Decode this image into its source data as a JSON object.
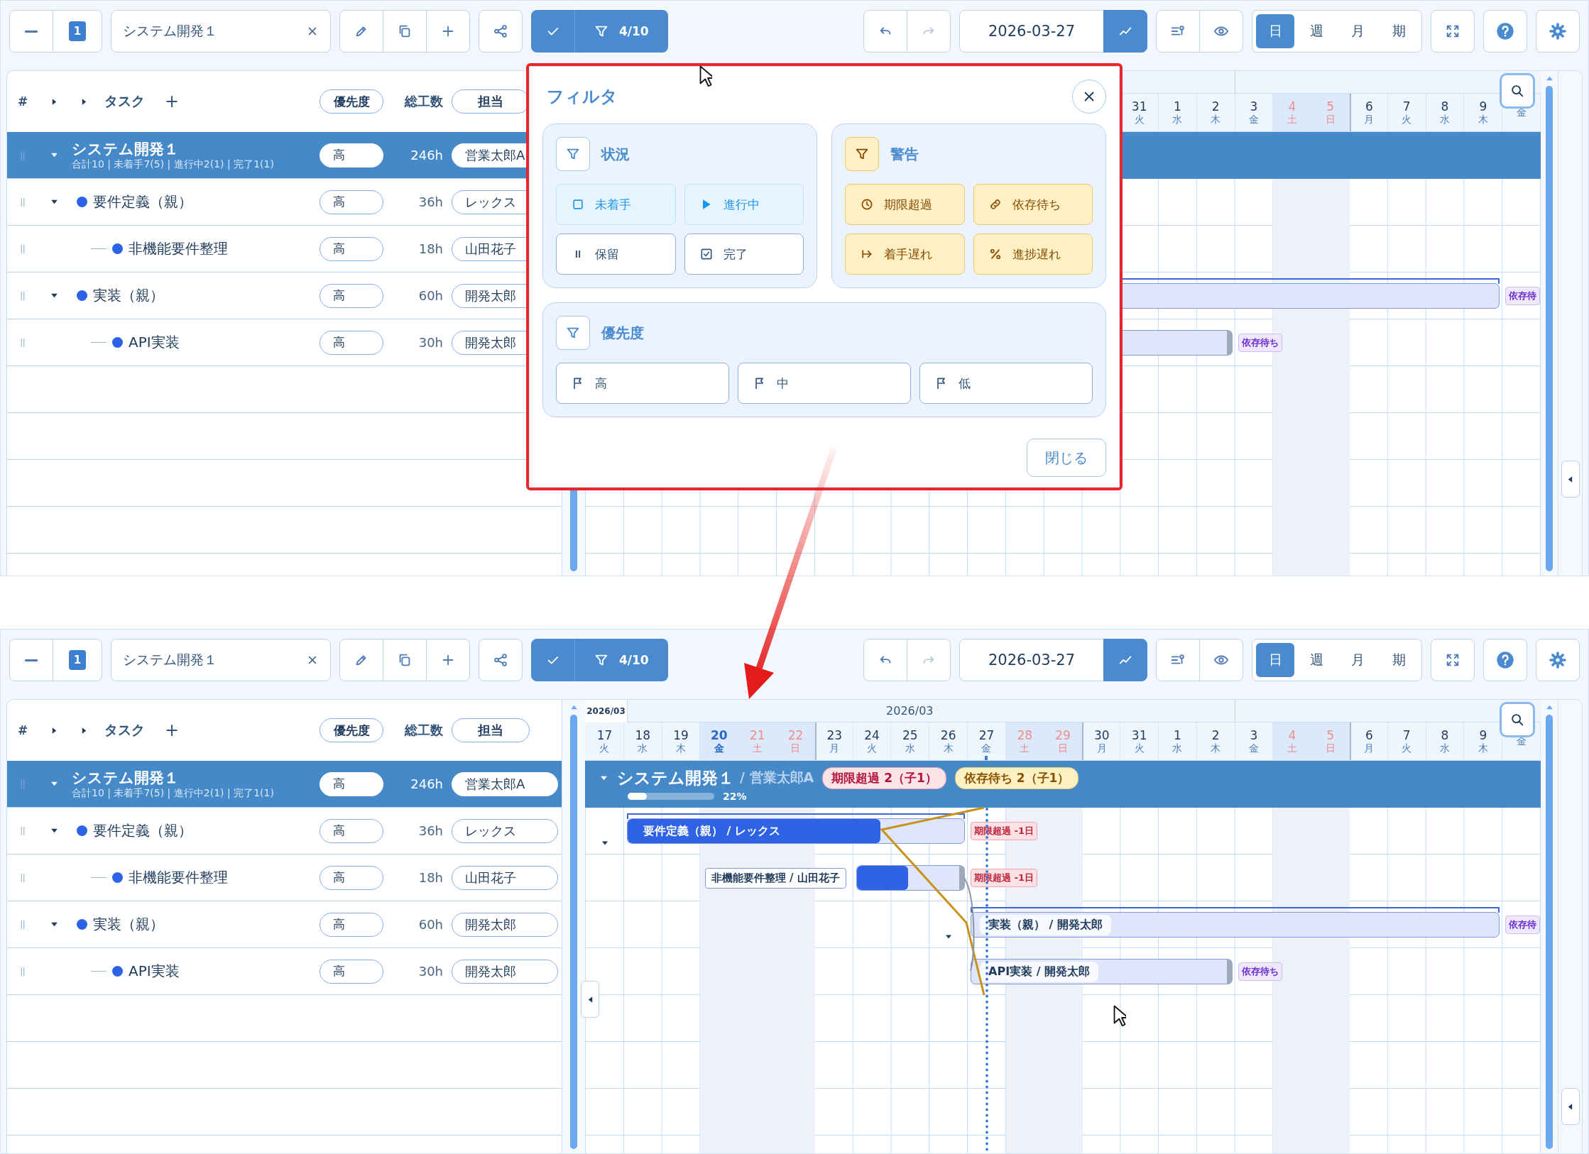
{
  "screens": [
    {
      "toolbar": {
        "level_badge": "1",
        "project": "システム開発１",
        "filter_active": true,
        "filter_count": "4/10",
        "undo_disabled": false,
        "redo_disabled": true,
        "date": "2026-03-27",
        "views": [
          {
            "label": "日",
            "selected": true
          },
          {
            "label": "週",
            "selected": false
          },
          {
            "label": "月",
            "selected": false
          },
          {
            "label": "期",
            "selected": false
          }
        ]
      },
      "table": {
        "header": {
          "number": "#",
          "task": "タスク",
          "add": "+",
          "priority": "優先度",
          "effort": "総工数",
          "assignee": "担当"
        },
        "project": {
          "name": "システム開発１",
          "summary": "合計10 | 未着手7(5) | 進行中2(1) | 完了1(1)",
          "expanded": true,
          "selected": true,
          "priority": "高",
          "effort": "246h",
          "assignee": "営業太郎A"
        },
        "tasks": [
          {
            "name": "要件定義（親）",
            "expanded": true,
            "selected": false,
            "priority": "高",
            "effort": "36h",
            "assignee": "レックス",
            "children": [
              {
                "name": "非機能要件整理",
                "selected": false,
                "priority": "高",
                "effort": "18h",
                "assignee": "山田花子"
              }
            ]
          },
          {
            "name": "実装（親）",
            "expanded": true,
            "selected": false,
            "priority": "高",
            "effort": "60h",
            "assignee": "開発太郎",
            "bar": {
              "parent": true,
              "tag": {
                "text": "依存待",
                "kind": "waiting"
              }
            },
            "children": [
              {
                "name": "API実装",
                "selected": false,
                "priority": "高",
                "effort": "30h",
                "assignee": "開発太郎",
                "bar": {
                  "parent": false,
                  "tag": {
                    "text": "依存待ち",
                    "kind": "waiting"
                  }
                }
              }
            ]
          }
        ]
      },
      "gantt": {
        "days": [
          {
            "day": "31",
            "weekday": "火",
            "kind": "weekday"
          },
          {
            "day": "1",
            "weekday": "水",
            "kind": "weekday"
          },
          {
            "day": "2",
            "weekday": "木",
            "kind": "weekday"
          },
          {
            "day": "3",
            "weekday": "金",
            "kind": "weekday"
          },
          {
            "day": "4",
            "weekday": "土",
            "kind": "saturday"
          },
          {
            "day": "5",
            "weekday": "日",
            "kind": "sunday"
          },
          {
            "day": "6",
            "weekday": "月",
            "kind": "weekday"
          },
          {
            "day": "7",
            "weekday": "火",
            "kind": "weekday"
          },
          {
            "day": "8",
            "weekday": "水",
            "kind": "weekday"
          },
          {
            "day": "9",
            "weekday": "木",
            "kind": "weekday"
          },
          {
            "weekday": "金",
            "kind": "weekday"
          }
        ]
      },
      "filter_dialog": {
        "title": "フィルタ",
        "close_label": "閉じる",
        "sections": [
          {
            "title": "状況",
            "kind": "status",
            "active": false,
            "options": [
              {
                "label": "未着手",
                "selected": true
              },
              {
                "label": "進行中",
                "selected": true
              },
              {
                "label": "保留",
                "selected": false
              },
              {
                "label": "完了",
                "selected": false
              }
            ]
          },
          {
            "title": "警告",
            "kind": "warning",
            "active": true,
            "options": [
              {
                "label": "期限超過",
                "selected": true
              },
              {
                "label": "依存待ち",
                "selected": true
              },
              {
                "label": "着手遅れ",
                "selected": true
              },
              {
                "label": "進捗遅れ",
                "selected": true
              }
            ]
          },
          {
            "title": "優先度",
            "kind": "priority",
            "active": false,
            "options": [
              {
                "label": "高",
                "selected": false
              },
              {
                "label": "中",
                "selected": false
              },
              {
                "label": "低",
                "selected": false
              }
            ]
          }
        ]
      }
    },
    {
      "toolbar": {
        "level_badge": "1",
        "project": "システム開発１",
        "filter_active": true,
        "filter_count": "4/10",
        "undo_disabled": false,
        "redo_disabled": true,
        "date": "2026-03-27",
        "views": [
          {
            "label": "日",
            "selected": true
          },
          {
            "label": "週",
            "selected": false
          },
          {
            "label": "月",
            "selected": false
          },
          {
            "label": "期",
            "selected": false
          }
        ]
      },
      "table": {
        "header": {
          "number": "#",
          "task": "タスク",
          "add": "+",
          "priority": "優先度",
          "effort": "総工数",
          "assignee": "担当"
        },
        "project": {
          "name": "システム開発１",
          "summary": "合計10 | 未着手7(5) | 進行中2(1) | 完了1(1)",
          "expanded": true,
          "selected": true,
          "priority": "高",
          "effort": "246h",
          "assignee": "営業太郎A"
        },
        "tasks": [
          {
            "name": "要件定義（親）",
            "expanded": true,
            "selected": false,
            "priority": "高",
            "effort": "36h",
            "assignee": "レックス",
            "bar": {
              "parent": true,
              "level": 0.75,
              "label": "要件定義（親） / レックス",
              "kind": "filled",
              "tag": {
                "text": "期限超過 -1日",
                "kind": "overdue"
              }
            },
            "children": [
              {
                "name": "非機能要件整理",
                "selected": false,
                "priority": "高",
                "effort": "18h",
                "assignee": "山田花子",
                "bar": {
                  "parent": false,
                  "level": 0.5,
                  "label": "非機能要件整理 / 山田花子",
                  "kind": "outside",
                  "tag": {
                    "text": "期限超過 -1日",
                    "kind": "overdue"
                  }
                }
              }
            ]
          },
          {
            "name": "実装（親）",
            "expanded": true,
            "selected": false,
            "priority": "高",
            "effort": "60h",
            "assignee": "開発太郎",
            "bar": {
              "parent": true,
              "label": "実装（親） / 開発太郎",
              "kind": "pill",
              "tag": {
                "text": "依存待",
                "kind": "waiting"
              }
            },
            "children": [
              {
                "name": "API実装",
                "selected": false,
                "priority": "高",
                "effort": "30h",
                "assignee": "開発太郎",
                "bar": {
                  "parent": false,
                  "label": "API実装 / 開発太郎",
                  "kind": "pill",
                  "tag": {
                    "text": "依存待ち",
                    "kind": "waiting"
                  }
                }
              }
            ]
          }
        ]
      },
      "gantt": {
        "sticky_month": "2026/03",
        "month": "2026/03",
        "dependency_lines": true,
        "days": [
          {
            "day": "17",
            "weekday": "火",
            "kind": "weekday",
            "today": false
          },
          {
            "day": "18",
            "weekday": "水",
            "kind": "weekday",
            "today": false
          },
          {
            "day": "19",
            "weekday": "木",
            "kind": "weekday",
            "today": false
          },
          {
            "day": "20",
            "weekday": "金",
            "kind": "holiday",
            "today": false
          },
          {
            "day": "21",
            "weekday": "土",
            "kind": "saturday",
            "today": false
          },
          {
            "day": "22",
            "weekday": "日",
            "kind": "sunday",
            "today": false
          },
          {
            "day": "23",
            "weekday": "月",
            "kind": "weekday",
            "today": false
          },
          {
            "day": "24",
            "weekday": "火",
            "kind": "weekday",
            "today": false
          },
          {
            "day": "25",
            "weekday": "水",
            "kind": "weekday",
            "today": false
          },
          {
            "day": "26",
            "weekday": "木",
            "kind": "weekday",
            "today": false
          },
          {
            "day": "27",
            "weekday": "金",
            "kind": "weekday",
            "today": true
          },
          {
            "day": "28",
            "weekday": "土",
            "kind": "saturday",
            "today": false
          },
          {
            "day": "29",
            "weekday": "日",
            "kind": "sunday",
            "today": false
          },
          {
            "day": "30",
            "weekday": "月",
            "kind": "weekday",
            "today": false
          },
          {
            "day": "31",
            "weekday": "火",
            "kind": "weekday",
            "today": false
          },
          {
            "day": "1",
            "weekday": "水",
            "kind": "weekday",
            "today": false
          },
          {
            "day": "2",
            "weekday": "木",
            "kind": "weekday",
            "today": false
          },
          {
            "day": "3",
            "weekday": "金",
            "kind": "weekday",
            "today": false
          },
          {
            "day": "4",
            "weekday": "土",
            "kind": "saturday",
            "today": false
          },
          {
            "day": "5",
            "weekday": "日",
            "kind": "sunday",
            "today": false
          },
          {
            "day": "6",
            "weekday": "月",
            "kind": "weekday",
            "today": false
          },
          {
            "day": "7",
            "weekday": "火",
            "kind": "weekday",
            "today": false
          },
          {
            "day": "8",
            "weekday": "水",
            "kind": "weekday",
            "today": false
          },
          {
            "day": "9",
            "weekday": "木",
            "kind": "weekday",
            "today": false
          },
          {
            "weekday": "金",
            "kind": "weekday",
            "today": false
          }
        ],
        "band": {
          "title": "システム開発１",
          "owner": "/ 営業太郎A",
          "expanded": true,
          "warnings": [
            {
              "text": "期限超過 2（子1）",
              "kind": "overdue"
            },
            {
              "text": "依存待ち 2（子1）",
              "kind": "waiting"
            }
          ],
          "progress": {
            "level": 0.22,
            "label": "22%"
          }
        }
      }
    }
  ]
}
